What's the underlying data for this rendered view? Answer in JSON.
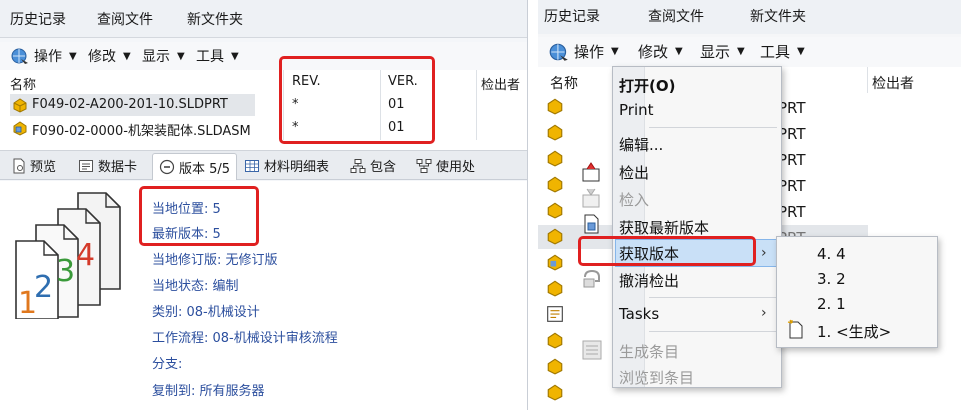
{
  "left": {
    "menubar": {
      "history": "历史记录",
      "view_file": "查阅文件",
      "new_folder": "新文件夹"
    },
    "toolbar": {
      "operations": "操作",
      "modify": "修改",
      "display": "显示",
      "tools": "工具"
    },
    "table": {
      "headers": {
        "name": "名称",
        "rev": "REV.",
        "ver": "VER.",
        "checked_out_by": "检出者"
      },
      "rows": [
        {
          "name": "F049-02-A200-201-10.SLDPRT",
          "rev": "*",
          "ver": "01"
        },
        {
          "name": "F090-02-0000-机架装配体.SLDASM",
          "rev": "*",
          "ver": "01"
        }
      ]
    },
    "tabs": {
      "preview": "预览",
      "datacard": "数据卡",
      "version": "版本 5/5",
      "bom": "材料明细表",
      "contains": "包含",
      "where_used": "使用处"
    },
    "details": {
      "local_position": "当地位置: 5",
      "latest_version": "最新版本: 5",
      "local_revision": "当地修订版: 无修订版",
      "local_state": "当地状态: 编制",
      "category": "类别: 08-机械设计",
      "workflow": "工作流程: 08-机械设计审核流程",
      "branch": "分支:",
      "copied_to": "复制到: 所有服务器"
    },
    "stack_numbers": [
      "1",
      "2",
      "3",
      "4"
    ]
  },
  "right": {
    "menubar": {
      "history": "历史记录",
      "view_file": "查阅文件",
      "new_folder": "新文件夹"
    },
    "toolbar": {
      "operations": "操作",
      "modify": "修改",
      "display": "显示",
      "tools": "工具"
    },
    "list_header": {
      "name_partial": "名称",
      "checked_out_by": "检出者"
    },
    "list_suffixes": [
      "PRT",
      "PRT",
      "PRT",
      "PRT",
      "PRT",
      "PRT"
    ],
    "dropdown": {
      "open": "打开(O)",
      "print": "Print",
      "edit": "编辑...",
      "checkout": "检出",
      "checkin": "检入",
      "get_latest": "获取最新版本",
      "get_version": "获取版本",
      "undo_checkout": "撤消检出",
      "tasks": "Tasks",
      "generate_item": "生成条目",
      "browse_item": "浏览到条目"
    },
    "submenu": [
      "4. 4",
      "3. 2",
      "2. 1",
      "1. <生成>"
    ]
  }
}
